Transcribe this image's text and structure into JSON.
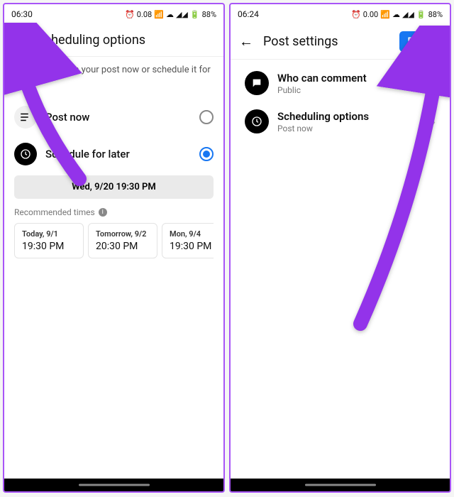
{
  "left": {
    "status": {
      "time": "06:30",
      "battery": "88%",
      "net": "0.08"
    },
    "header": {
      "title": "Scheduling options"
    },
    "subtitle": "You can publish your post now or schedule it for later.",
    "options": {
      "post_now": "Post now",
      "schedule_later": "Schedule for later"
    },
    "schedule_display": "Wed, 9/20 19:30 PM",
    "recommended_label": "Recommended times",
    "recommended": [
      {
        "day": "Today, 9/1",
        "time": "19:30 PM"
      },
      {
        "day": "Tomorrow, 9/2",
        "time": "20:30 PM"
      },
      {
        "day": "Mon, 9/4",
        "time": "19:30 PM"
      }
    ]
  },
  "right": {
    "status": {
      "time": "06:24",
      "battery": "88%",
      "net": "0.00"
    },
    "header": {
      "title": "Post settings",
      "post_btn": "POST"
    },
    "settings": {
      "comment_title": "Who can comment",
      "comment_sub": "Public",
      "sched_title": "Scheduling options",
      "sched_sub": "Post now"
    }
  },
  "arrow_color": "#9333ea"
}
